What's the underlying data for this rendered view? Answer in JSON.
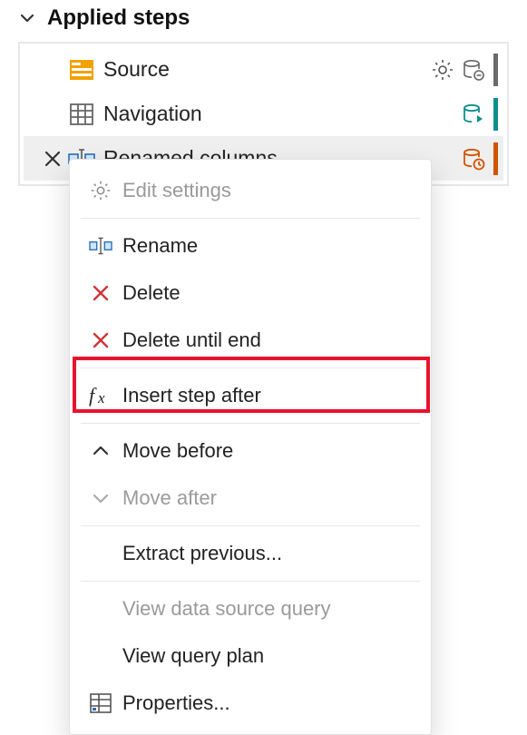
{
  "panel": {
    "title": "Applied steps"
  },
  "steps": [
    {
      "label": "Source"
    },
    {
      "label": "Navigation"
    },
    {
      "label": "Renamed columns"
    }
  ],
  "menu": {
    "edit_settings": "Edit settings",
    "rename": "Rename",
    "delete": "Delete",
    "delete_until_end": "Delete until end",
    "insert_step_after": "Insert step after",
    "move_before": "Move before",
    "move_after": "Move after",
    "extract_previous": "Extract previous...",
    "view_data_source_query": "View data source query",
    "view_query_plan": "View query plan",
    "properties": "Properties..."
  }
}
